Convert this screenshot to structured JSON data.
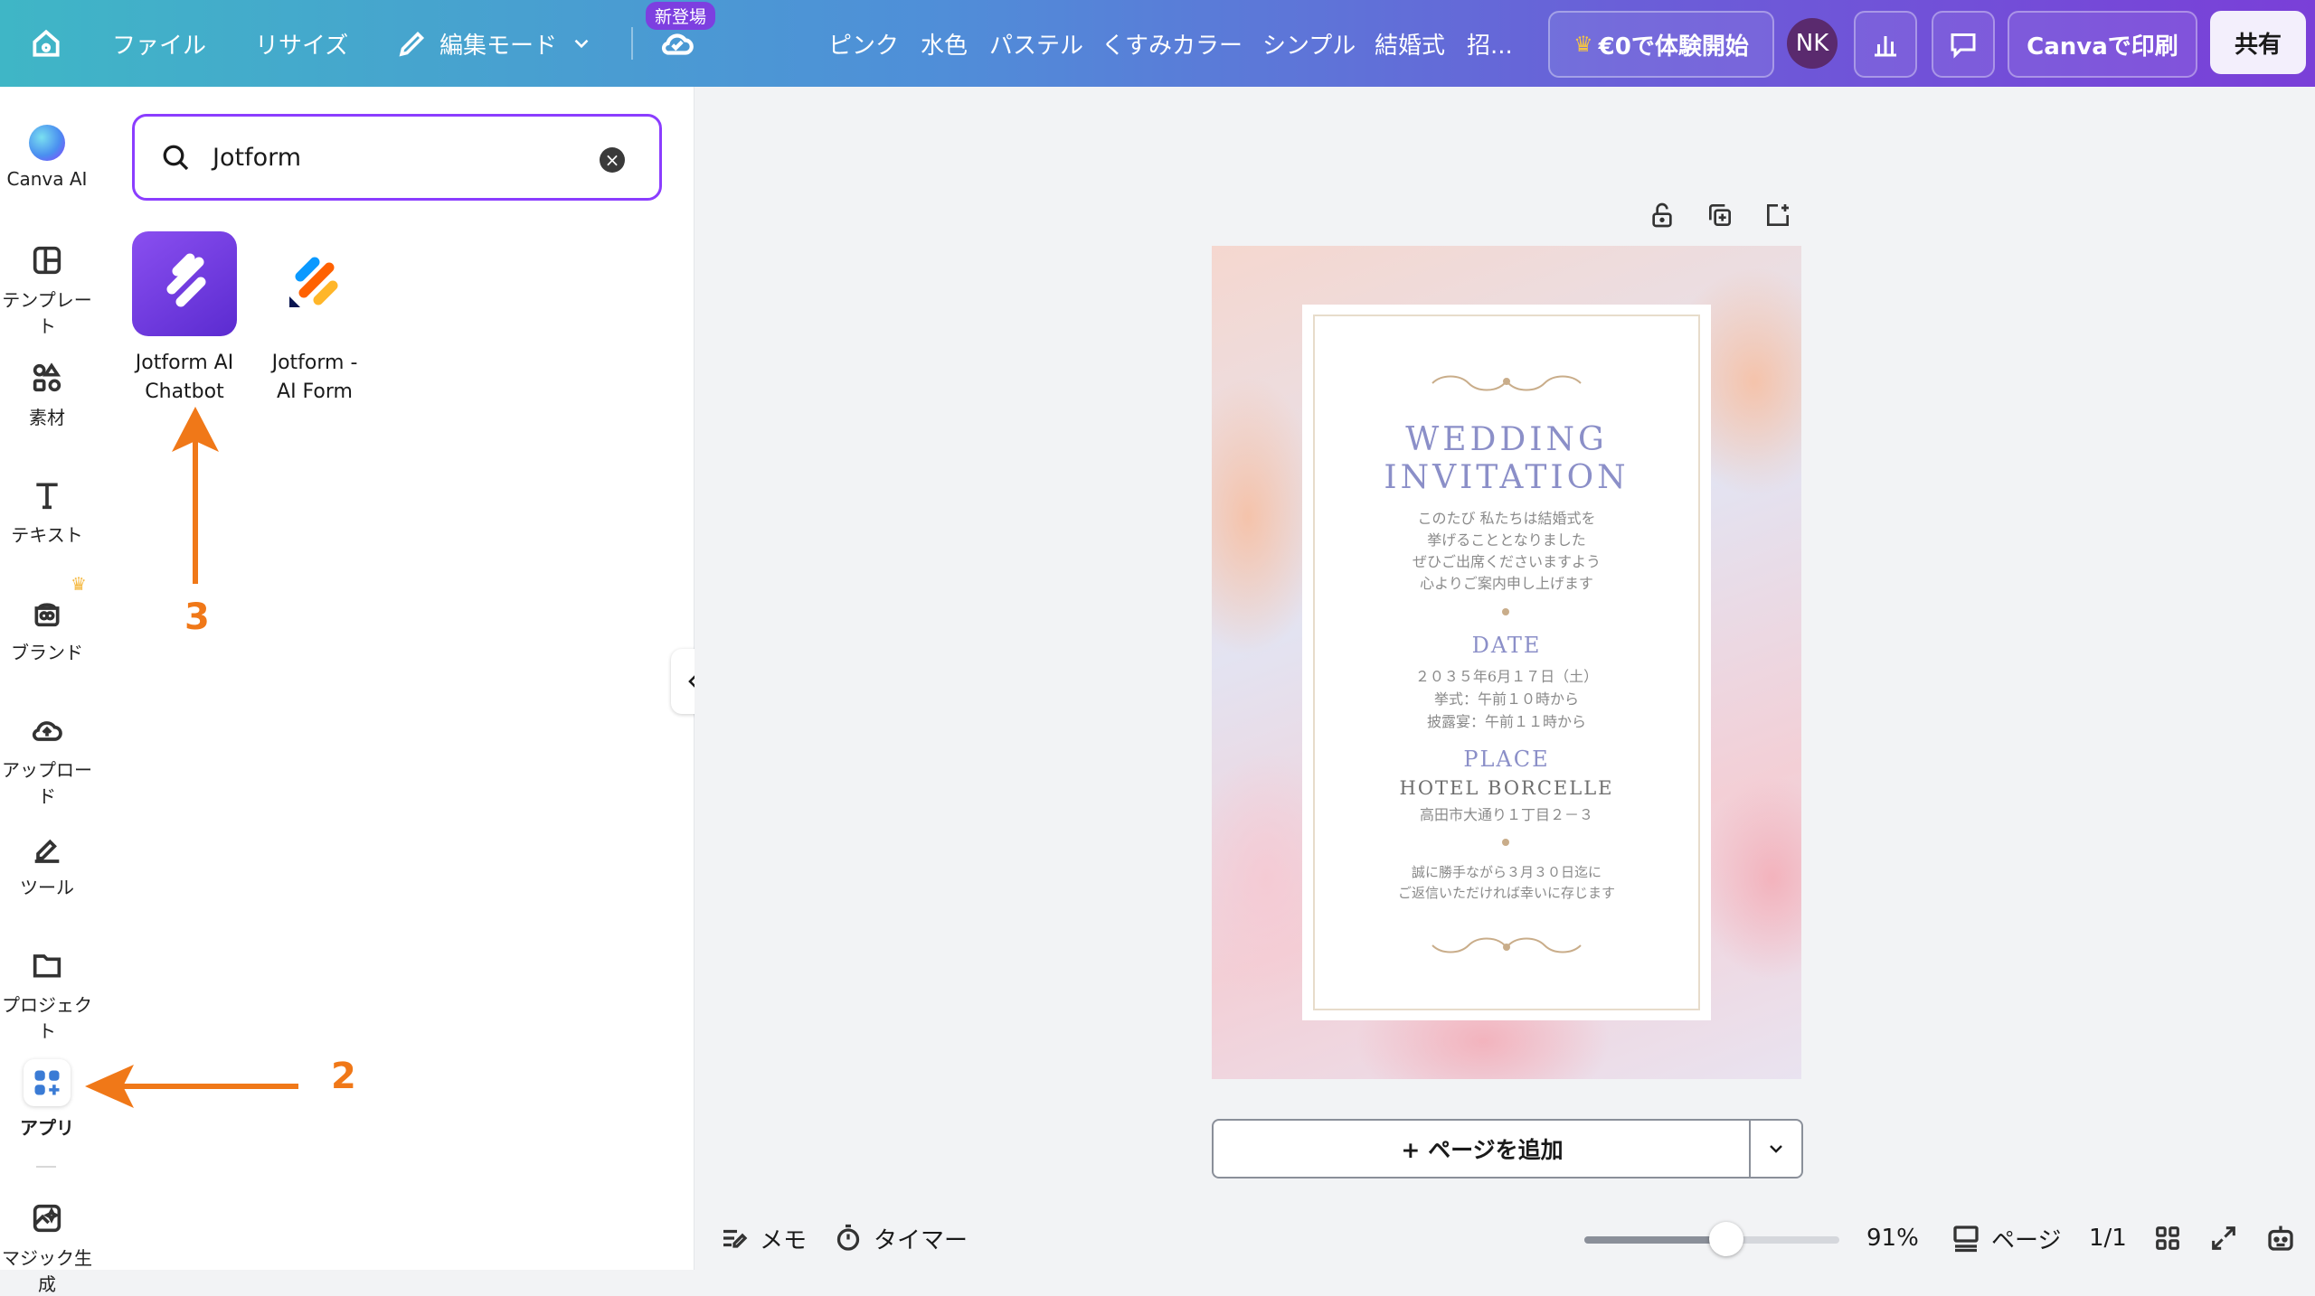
{
  "topbar": {
    "file": "ファイル",
    "resize": "リサイズ",
    "edit_mode": "編集モード",
    "new_badge": "新登場",
    "suggestions": [
      "ピンク",
      "水色",
      "パステル",
      "くすみカラー",
      "シンプル",
      "結婚式",
      "招..."
    ],
    "trial": "€0で体験開始",
    "avatar": "NK",
    "print": "Canvaで印刷",
    "share": "共有"
  },
  "rail": {
    "items": [
      {
        "label": "Canva AI"
      },
      {
        "label": "テンプレート"
      },
      {
        "label": "素材"
      },
      {
        "label": "テキスト"
      },
      {
        "label": "ブランド"
      },
      {
        "label": "アップロード"
      },
      {
        "label": "ツール"
      },
      {
        "label": "プロジェクト"
      },
      {
        "label": "アプリ"
      },
      {
        "label": "マジック生成"
      }
    ]
  },
  "search": {
    "value": "Jotform"
  },
  "apps": [
    {
      "name_line1": "Jotform AI",
      "name_line2": "Chatbot"
    },
    {
      "name_line1": "Jotform -",
      "name_line2": "AI Form"
    }
  ],
  "annotations": {
    "step2": "2",
    "step3": "3"
  },
  "design": {
    "title1": "WEDDING",
    "title2": "INVITATION",
    "message": [
      "このたび 私たちは結婚式を",
      "挙げることとなりました",
      "ぜひご出席くださいますよう",
      "心よりご案内申し上げます"
    ],
    "date_heading": "DATE",
    "date_lines": [
      "２０３５年6月１７日（土）",
      "挙式：午前１０時から",
      "披露宴：午前１１時から"
    ],
    "place_heading": "PLACE",
    "place_name": "HOTEL BORCELLE",
    "place_address": "高田市大通り１丁目２－３",
    "rsvp": [
      "誠に勝手ながら３月３０日迄に",
      "ご返信いただければ幸いに存じます"
    ]
  },
  "add_page": "+ ページを追加",
  "bottom": {
    "memo": "メモ",
    "timer": "タイマー",
    "zoom": "91%",
    "pages_label": "ページ",
    "page_count": "1/1"
  },
  "colors": {
    "accent": "#8b3dff",
    "annotation": "#f07818"
  }
}
